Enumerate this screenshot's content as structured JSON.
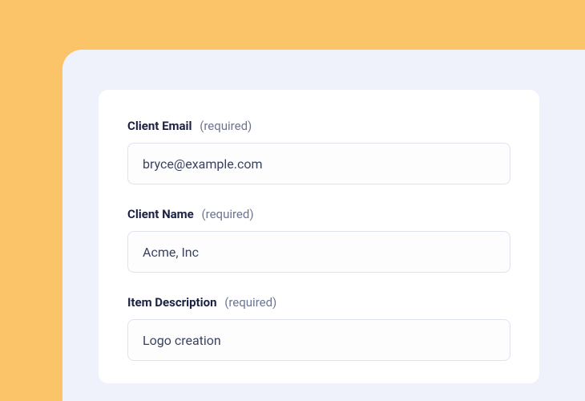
{
  "form": {
    "fields": [
      {
        "label": "Client Email",
        "required_text": "(required)",
        "value": "bryce@example.com"
      },
      {
        "label": "Client Name",
        "required_text": "(required)",
        "value": "Acme, Inc"
      },
      {
        "label": "Item Description",
        "required_text": "(required)",
        "value": "Logo creation"
      }
    ]
  }
}
